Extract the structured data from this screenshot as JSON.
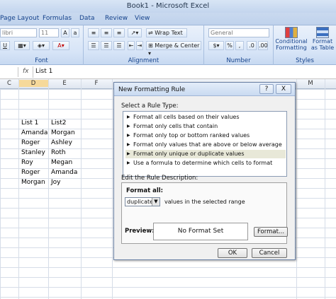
{
  "window": {
    "title": "Book1 - Microsoft Excel"
  },
  "ribbon_tabs": [
    "Page Layout",
    "Formulas",
    "Data",
    "Review",
    "View"
  ],
  "ribbon": {
    "font_name": "libri",
    "font_size": "11",
    "wrap_text": "Wrap Text",
    "merge_center": "Merge & Center",
    "number_format": "General",
    "percent": "%",
    "comma": ",",
    "conditional_formatting": [
      "Conditional",
      "Formatting"
    ],
    "format_as_table": [
      "Format",
      "as Table"
    ],
    "groups": {
      "font": "Font",
      "alignment": "Alignment",
      "number": "Number",
      "styles": "Styles"
    }
  },
  "formula_bar": {
    "fx": "fx",
    "value": "List 1"
  },
  "columns": [
    "C",
    "D",
    "E",
    "F",
    "M"
  ],
  "sheet": {
    "col_d": [
      "List 1",
      "Amanda",
      "Roger",
      "Stanley",
      "Roy",
      "Roger",
      "Morgan"
    ],
    "col_e": [
      "List2",
      "Morgan",
      "Ashley",
      "Roth",
      "Megan",
      "Amanda",
      "Joy"
    ]
  },
  "dialog": {
    "title": "New Formatting Rule",
    "help": "?",
    "close": "X",
    "select_rule_label": "Select a Rule Type:",
    "rule_types": [
      "Format all cells based on their values",
      "Format only cells that contain",
      "Format only top or bottom ranked values",
      "Format only values that are above or below average",
      "Format only unique or duplicate values",
      "Use a formula to determine which cells to format"
    ],
    "selected_index": 4,
    "edit_label": "Edit the Rule Description:",
    "format_all_label": "Format all:",
    "format_all_value": "duplicate",
    "format_all_suffix": "values in the selected range",
    "preview_label": "Preview:",
    "preview_text": "No Format Set",
    "format_button": "Format...",
    "ok": "OK",
    "cancel": "Cancel"
  }
}
